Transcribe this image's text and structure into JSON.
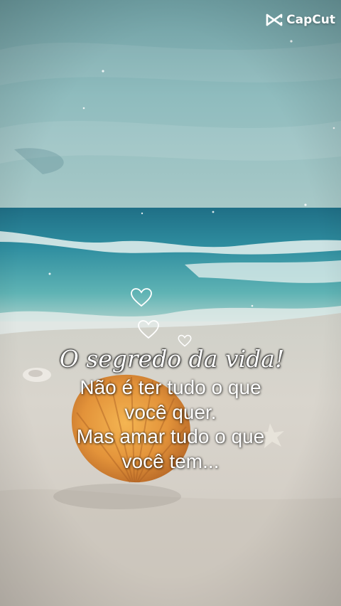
{
  "brand": {
    "logo_text": "CapCut",
    "logo_icon": "capcut-logo-icon"
  },
  "scene": {
    "description_icon": "beach-shell-background"
  },
  "hearts": [
    "heart-outline-icon",
    "heart-outline-icon",
    "heart-outline-icon"
  ],
  "caption": {
    "title": "O segredo da vida!",
    "lines": [
      "Não é ter tudo o que",
      "você quer.",
      "Mas amar tudo o que",
      "você tem..."
    ]
  },
  "colors": {
    "sky_top": "#6f9ea3",
    "sea": "#2f8a9e",
    "sand": "#d8d3cc",
    "shell": "#e39a3c",
    "text": "#ffffff"
  }
}
